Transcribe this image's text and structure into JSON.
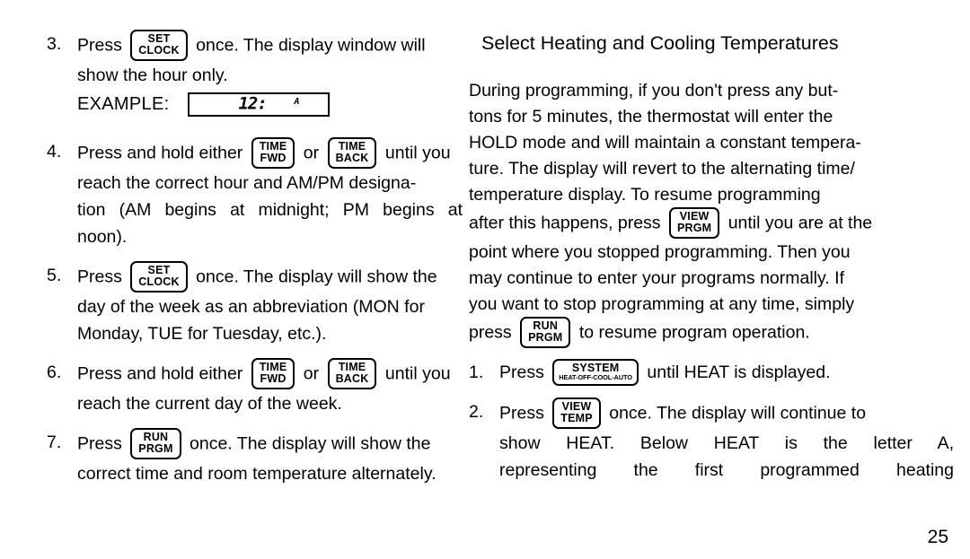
{
  "page": {
    "number": "25"
  },
  "left_column": {
    "steps": [
      {
        "number": "3.",
        "lines": [
          {
            "type": "mixed",
            "pre": "Press",
            "button": "set-clock",
            "post": "once.  The display window will"
          },
          {
            "type": "text",
            "text": "show the hour only."
          }
        ],
        "example": {
          "label": "EXAMPLE:",
          "lcd_digits": "12:",
          "lcd_ampm": "A"
        }
      },
      {
        "number": "4.",
        "lines": [
          {
            "type": "mixed2",
            "pre": "Press and hold either",
            "button1": "time-fwd",
            "mid": "or",
            "button2": "time-back",
            "post": "until you"
          },
          {
            "type": "text",
            "text": "reach the correct hour and AM/PM designa-"
          },
          {
            "type": "just",
            "text": "tion (AM begins at midnight; PM begins at"
          },
          {
            "type": "text",
            "text": "noon)."
          }
        ]
      },
      {
        "number": "5.",
        "lines": [
          {
            "type": "mixed",
            "pre": "Press",
            "button": "set-clock",
            "post": "once.  The display will show the"
          },
          {
            "type": "text",
            "text": "day of the week as an abbreviation (MON for"
          },
          {
            "type": "text",
            "text": "Monday, TUE for Tuesday, etc.)."
          }
        ]
      },
      {
        "number": "6.",
        "lines": [
          {
            "type": "mixed2",
            "pre": "Press and hold either",
            "button1": "time-fwd",
            "mid": "or",
            "button2": "time-back",
            "post": "until you"
          },
          {
            "type": "text",
            "text": "reach the current day of the week."
          }
        ]
      },
      {
        "number": "7.",
        "lines": [
          {
            "type": "mixed",
            "pre": "Press",
            "button": "run-prgm",
            "post": "once.  The display will show the"
          },
          {
            "type": "text",
            "text": "correct time and room temperature alternately."
          }
        ]
      }
    ]
  },
  "right_column": {
    "heading": "Select Heating and Cooling Temperatures",
    "paragraph": {
      "lines": [
        "During programming, if you don't press any but-",
        "tons for 5 minutes, the thermostat will enter the",
        "HOLD mode and will maintain a constant tempera-",
        "ture.  The display will revert to the alternating time/",
        "temperature display.   To resume programming"
      ],
      "line_with_button_1": {
        "pre": "after this happens, press",
        "button": "view-prgm",
        "post": "until you are at the"
      },
      "lines_2": [
        "point where you stopped programming.  Then you",
        "may continue to enter your programs normally.  If",
        "you want to stop programming at any time, simply"
      ],
      "line_with_button_2": {
        "pre": "press",
        "button": "run-prgm",
        "post": "to resume program operation."
      }
    },
    "steps": [
      {
        "number": "1.",
        "lines": [
          {
            "type": "mixed",
            "pre": "Press",
            "button": "system",
            "post": "until HEAT is displayed."
          }
        ]
      },
      {
        "number": "2.",
        "lines": [
          {
            "type": "mixed",
            "pre": "Press",
            "button": "view-temp",
            "post": "once. The display will continue to"
          },
          {
            "type": "just",
            "text": "show HEAT.  Below HEAT is the letter A,"
          },
          {
            "type": "just",
            "text": "representing the first programmed heating"
          }
        ]
      }
    ]
  },
  "buttons": {
    "set-clock": {
      "line1": "SET",
      "line2": "CLOCK",
      "sub": ""
    },
    "time-fwd": {
      "line1": "TIME",
      "line2": "FWD",
      "sub": ""
    },
    "time-back": {
      "line1": "TIME",
      "line2": "BACK",
      "sub": ""
    },
    "run-prgm": {
      "line1": "RUN",
      "line2": "PRGM",
      "sub": ""
    },
    "view-prgm": {
      "line1": "VIEW",
      "line2": "PRGM",
      "sub": ""
    },
    "view-temp": {
      "line1": "VIEW",
      "line2": "TEMP",
      "sub": ""
    },
    "system": {
      "line1": "SYSTEM",
      "line2": "",
      "sub": "HEAT-OFF-COOL-AUTO"
    }
  },
  "colors": {
    "ink": "#000000",
    "paper": "#ffffff"
  }
}
